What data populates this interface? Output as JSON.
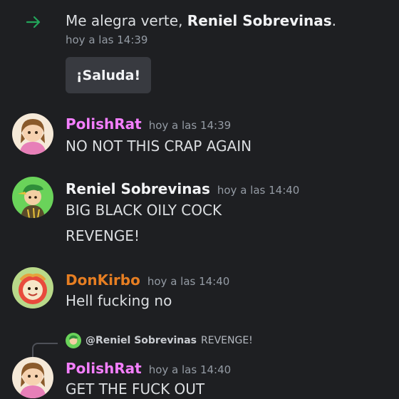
{
  "system": {
    "join_prefix": "Me alegra verte, ",
    "join_user": "Reniel Sobrevinas",
    "join_suffix": ".",
    "timestamp": "hoy a las 14:39",
    "wave_button": "¡Saluda!",
    "accent": "#23a55a"
  },
  "messages": [
    {
      "author": "PolishRat",
      "author_color": "#f47fff",
      "timestamp": "hoy a las 14:39",
      "lines": [
        "NO NOT THIS CRAP AGAIN"
      ]
    },
    {
      "author": "Reniel Sobrevinas",
      "author_color": "#f2f3f5",
      "timestamp": "hoy a las 14:40",
      "lines": [
        "BIG BLACK OILY COCK",
        "REVENGE!"
      ]
    },
    {
      "author": "DonKirbo",
      "author_color": "#e67e22",
      "timestamp": "hoy a las 14:40",
      "lines": [
        "Hell fucking no"
      ]
    },
    {
      "reply": {
        "mention": "@Reniel Sobrevinas",
        "quote": "REVENGE!"
      },
      "author": "PolishRat",
      "author_color": "#f47fff",
      "timestamp": "hoy a las 14:40",
      "lines": [
        "GET THE FUCK OUT"
      ]
    }
  ]
}
